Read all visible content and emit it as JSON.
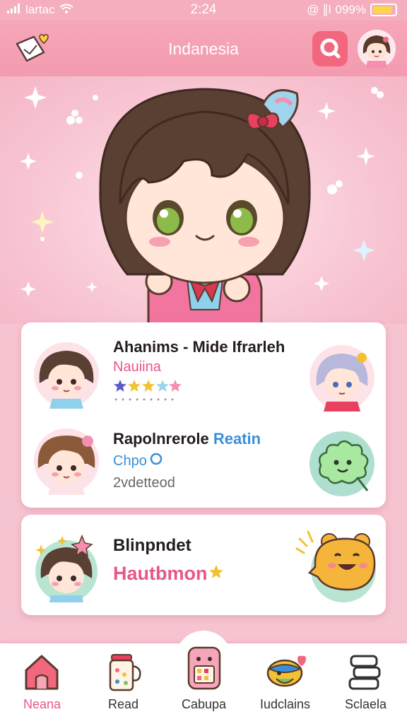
{
  "status_bar": {
    "carrier": "lartac",
    "time": "2:24",
    "signal_text": "@ ∥l",
    "battery_text": "099%"
  },
  "header": {
    "title": "Indanesia"
  },
  "cards": [
    {
      "title": "Ahanims - Mide Ifrarleh",
      "subtitle": "Nauiina",
      "rating_stars": 4
    },
    {
      "title": "Rapolnrerole",
      "title_accent": "Reatin",
      "subtitle": "Chpo",
      "status": "2vdetteod"
    },
    {
      "title": "Blinpndet",
      "subtitle": "Hautbmon"
    }
  ],
  "bottom_nav": [
    {
      "label": "Neana",
      "icon": "home-icon",
      "active": true
    },
    {
      "label": "Read",
      "icon": "jar-icon",
      "active": false
    },
    {
      "label": "Cabupa",
      "icon": "pink-character-icon",
      "active": false
    },
    {
      "label": "Iudclains",
      "icon": "fish-icon",
      "active": false
    },
    {
      "label": "Sclaela",
      "icon": "stack-icon",
      "active": false
    }
  ],
  "colors": {
    "header": "#f39bb0",
    "accent_pink": "#e8568b",
    "accent_blue": "#3a8fd8",
    "search_button": "#f2677e"
  }
}
